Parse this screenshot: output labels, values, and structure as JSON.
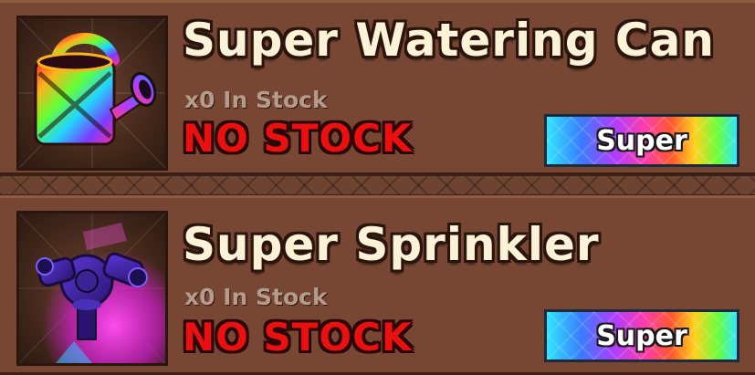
{
  "shop": {
    "items": [
      {
        "name": "Super Watering Can",
        "stock_text": "x0 In Stock",
        "status": "NO STOCK",
        "rarity": "Super",
        "icon": "watering-can-icon"
      },
      {
        "name": "Super Sprinkler",
        "stock_text": "x0 In Stock",
        "status": "NO STOCK",
        "rarity": "Super",
        "icon": "sprinkler-icon"
      }
    ]
  },
  "colors": {
    "panel": "#774733",
    "title": "#fbf2d8",
    "status": "#ea1010",
    "stock_text": "#b59b8a"
  }
}
